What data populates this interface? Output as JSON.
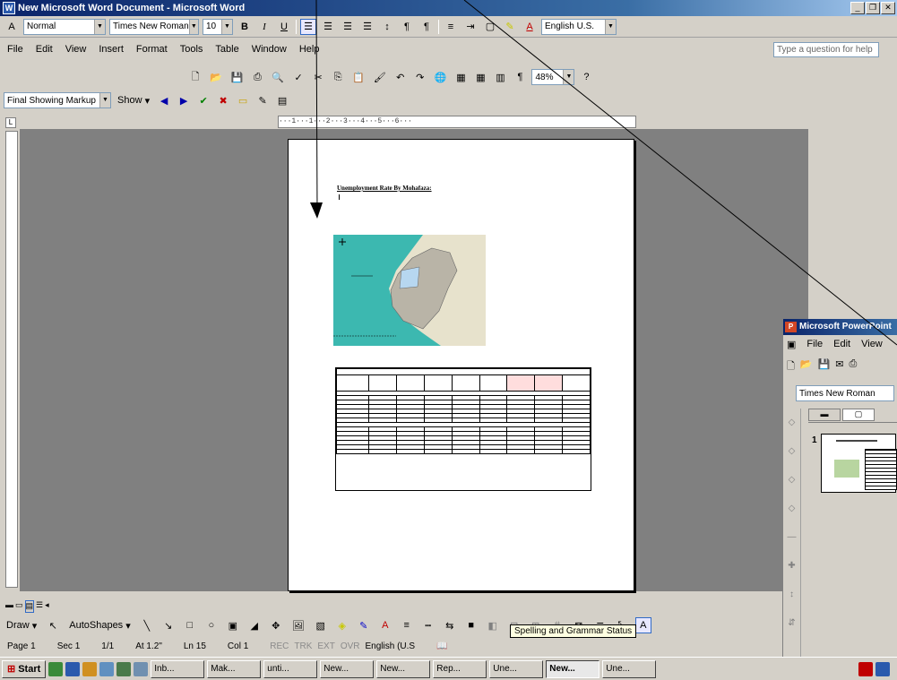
{
  "word": {
    "title": "New Microsoft Word Document - Microsoft Word",
    "formatting": {
      "style": "Normal",
      "font": "Times New Roman",
      "size": "10",
      "language": "English U.S."
    },
    "menu": [
      "File",
      "Edit",
      "View",
      "Insert",
      "Format",
      "Tools",
      "Table",
      "Window",
      "Help"
    ],
    "help_placeholder": "Type a question for help",
    "zoom": "48%",
    "review": {
      "display": "Final Showing Markup",
      "show": "Show"
    },
    "document": {
      "heading": "Unemployment Rate By Mohafaza:"
    },
    "drawing": {
      "draw": "Draw",
      "autoshapes": "AutoShapes"
    },
    "status": {
      "page": "Page 1",
      "section": "Sec 1",
      "pages": "1/1",
      "at": "At 1.2\"",
      "line": "Ln 15",
      "col": "Col 1",
      "rec": "REC",
      "trk": "TRK",
      "ext": "EXT",
      "ovr": "OVR",
      "language": "English (U.S"
    },
    "tooltip": "Spelling and Grammar Status"
  },
  "powerpoint": {
    "title": "Microsoft PowerPoint",
    "menu": [
      "File",
      "Edit",
      "View"
    ],
    "font": "Times New Roman",
    "slide_number": "1"
  },
  "taskbar": {
    "start": "Start",
    "tasks": [
      "Inb...",
      "Mak...",
      "unti...",
      "New...",
      "New...",
      "Rep...",
      "Une...",
      "New...",
      "Une..."
    ],
    "active_task": 7
  },
  "colors": {
    "titlebar": "#0a246a",
    "map_sea": "#3cb8b0",
    "map_land": "#b9b4a7"
  }
}
